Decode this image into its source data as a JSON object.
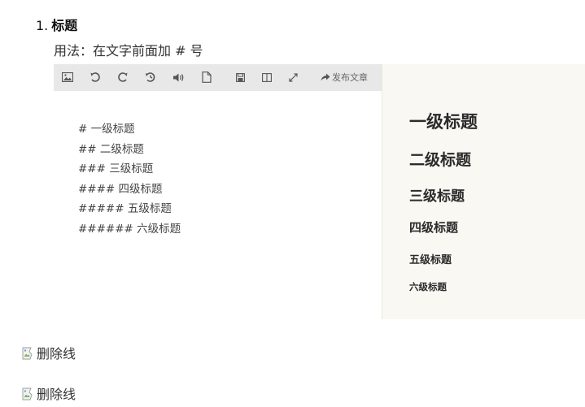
{
  "section": {
    "number": "1.",
    "title": "标题",
    "usage": "用法：在文字前面加 # 号"
  },
  "toolbar": {
    "buttons": [
      "image-icon",
      "undo-icon",
      "redo-icon",
      "history-icon",
      "audio-icon",
      "file-icon",
      "save-icon",
      "split-view-icon",
      "fullscreen-icon"
    ],
    "publish_label": "发布文章"
  },
  "editor": {
    "lines": [
      "# 一级标题",
      "## 二级标题",
      "### 三级标题",
      "#### 四级标题",
      "##### 五级标题",
      "###### 六级标题"
    ]
  },
  "preview": {
    "h1": "一级标题",
    "h2": "二级标题",
    "h3": "三级标题",
    "h4": "四级标题",
    "h5": "五级标题",
    "h6": "六级标题"
  },
  "images": [
    {
      "alt": "删除线"
    },
    {
      "alt": "删除线"
    }
  ]
}
